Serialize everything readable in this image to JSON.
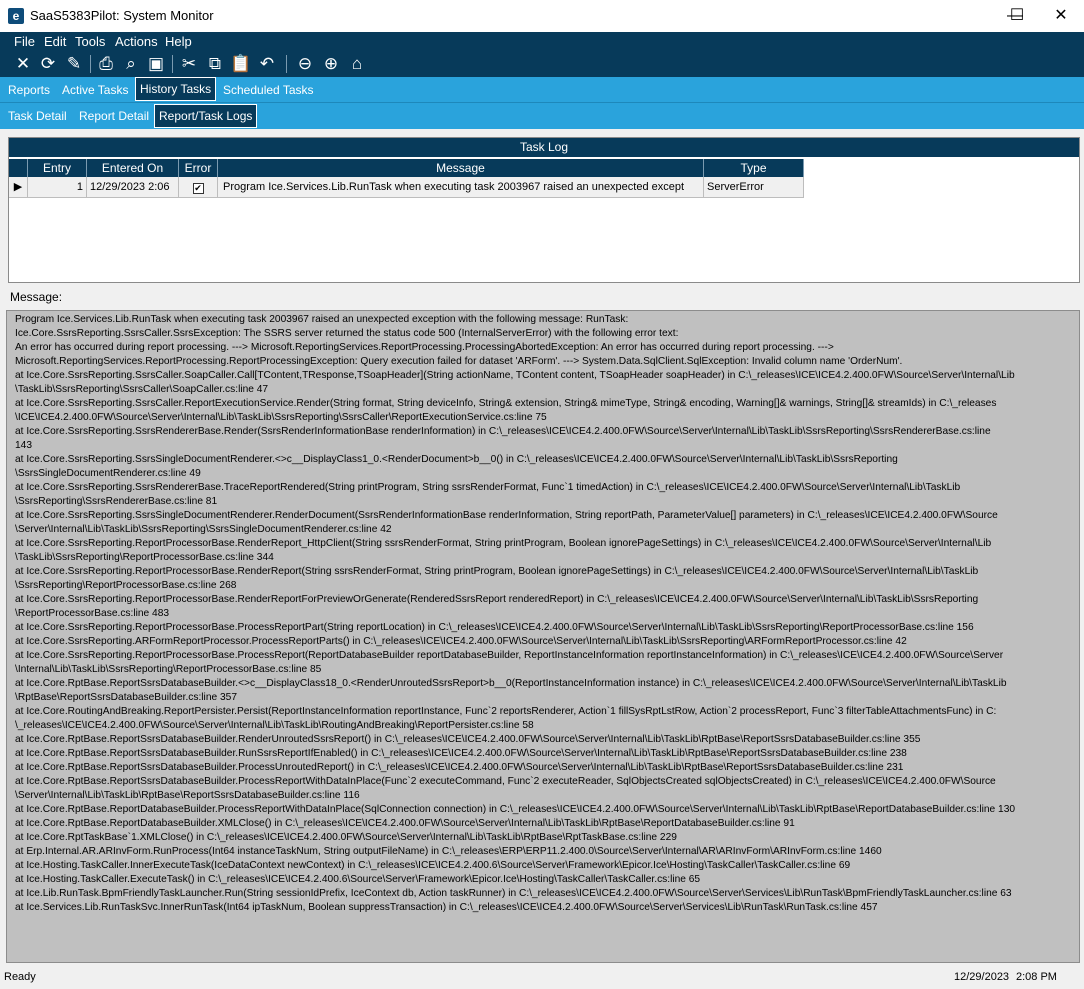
{
  "window": {
    "title": "SaaS5383Pilot: System Monitor",
    "app_icon_letter": "e"
  },
  "controls": {
    "minimize": "—",
    "maximize": "☐",
    "close": "✕"
  },
  "menu": [
    "File",
    "Edit",
    "Tools",
    "Actions",
    "Help"
  ],
  "toolbar": [
    "close-icon",
    "refresh-icon",
    "clear-icon",
    "print-icon",
    "print-preview-icon",
    "save-icon",
    "cut-icon",
    "copy-icon",
    "paste-icon",
    "undo-icon",
    "back-icon",
    "forward-icon",
    "home-icon"
  ],
  "tabs_main": [
    "Reports",
    "Active Tasks",
    "History Tasks",
    "Scheduled Tasks"
  ],
  "tabs_sub": [
    "Task Detail",
    "Report Detail",
    "Report/Task Logs"
  ],
  "grid": {
    "title": "Task Log",
    "columns": [
      "Entry",
      "Entered On",
      "Error",
      "Message",
      "Type"
    ],
    "row": {
      "entry": "1",
      "entered_on": "12/29/2023 2:06",
      "error": true,
      "message": "Program Ice.Services.Lib.RunTask when executing task 2003967 raised an unexpected except",
      "type": "ServerError"
    }
  },
  "message_label": "Message:",
  "message_lines": [
    "Program Ice.Services.Lib.RunTask when executing task 2003967 raised an unexpected exception with the following message: RunTask:",
    "Ice.Core.SsrsReporting.SsrsCaller.SsrsException: The SSRS server returned the status code 500 (InternalServerError) with the following error text:",
    "An error has occurred during report processing. ---> Microsoft.ReportingServices.ReportProcessing.ProcessingAbortedException: An error has occurred during report processing. --->",
    "Microsoft.ReportingServices.ReportProcessing.ReportProcessingException: Query execution failed for dataset 'ARForm'. ---> System.Data.SqlClient.SqlException: Invalid column name 'OrderNum'.",
    "   at Ice.Core.SsrsReporting.SsrsCaller.SoapCaller.Call[TContent,TResponse,TSoapHeader](String actionName, TContent content, TSoapHeader soapHeader) in C:\\_releases\\ICE\\ICE4.2.400.0FW\\Source\\Server\\Internal\\Lib",
    "\\TaskLib\\SsrsReporting\\SsrsCaller\\SoapCaller.cs:line 47",
    "   at Ice.Core.SsrsReporting.SsrsCaller.ReportExecutionService.Render(String format, String deviceInfo, String& extension, String& mimeType, String& encoding, Warning[]& warnings, String[]& streamIds) in C:\\_releases",
    "\\ICE\\ICE4.2.400.0FW\\Source\\Server\\Internal\\Lib\\TaskLib\\SsrsReporting\\SsrsCaller\\ReportExecutionService.cs:line 75",
    "   at Ice.Core.SsrsReporting.SsrsRendererBase.Render(SsrsRenderInformationBase renderInformation) in C:\\_releases\\ICE\\ICE4.2.400.0FW\\Source\\Server\\Internal\\Lib\\TaskLib\\SsrsReporting\\SsrsRendererBase.cs:line",
    "143",
    "   at Ice.Core.SsrsReporting.SsrsSingleDocumentRenderer.<>c__DisplayClass1_0.<RenderDocument>b__0() in C:\\_releases\\ICE\\ICE4.2.400.0FW\\Source\\Server\\Internal\\Lib\\TaskLib\\SsrsReporting",
    "\\SsrsSingleDocumentRenderer.cs:line 49",
    "   at Ice.Core.SsrsReporting.SsrsRendererBase.TraceReportRendered(String printProgram, String ssrsRenderFormat, Func`1 timedAction) in C:\\_releases\\ICE\\ICE4.2.400.0FW\\Source\\Server\\Internal\\Lib\\TaskLib",
    "\\SsrsReporting\\SsrsRendererBase.cs:line 81",
    "   at Ice.Core.SsrsReporting.SsrsSingleDocumentRenderer.RenderDocument(SsrsRenderInformationBase renderInformation, String reportPath, ParameterValue[] parameters) in C:\\_releases\\ICE\\ICE4.2.400.0FW\\Source",
    "\\Server\\Internal\\Lib\\TaskLib\\SsrsReporting\\SsrsSingleDocumentRenderer.cs:line 42",
    "   at Ice.Core.SsrsReporting.ReportProcessorBase.RenderReport_HttpClient(String ssrsRenderFormat, String printProgram, Boolean ignorePageSettings) in C:\\_releases\\ICE\\ICE4.2.400.0FW\\Source\\Server\\Internal\\Lib",
    "\\TaskLib\\SsrsReporting\\ReportProcessorBase.cs:line 344",
    "   at Ice.Core.SsrsReporting.ReportProcessorBase.RenderReport(String ssrsRenderFormat, String printProgram, Boolean ignorePageSettings) in C:\\_releases\\ICE\\ICE4.2.400.0FW\\Source\\Server\\Internal\\Lib\\TaskLib",
    "\\SsrsReporting\\ReportProcessorBase.cs:line 268",
    "   at Ice.Core.SsrsReporting.ReportProcessorBase.RenderReportForPreviewOrGenerate(RenderedSsrsReport renderedReport) in C:\\_releases\\ICE\\ICE4.2.400.0FW\\Source\\Server\\Internal\\Lib\\TaskLib\\SsrsReporting",
    "\\ReportProcessorBase.cs:line 483",
    "   at Ice.Core.SsrsReporting.ReportProcessorBase.ProcessReportPart(String reportLocation) in C:\\_releases\\ICE\\ICE4.2.400.0FW\\Source\\Server\\Internal\\Lib\\TaskLib\\SsrsReporting\\ReportProcessorBase.cs:line 156",
    "   at Ice.Core.SsrsReporting.ARFormReportProcessor.ProcessReportParts() in C:\\_releases\\ICE\\ICE4.2.400.0FW\\Source\\Server\\Internal\\Lib\\TaskLib\\SsrsReporting\\ARFormReportProcessor.cs:line 42",
    "   at Ice.Core.SsrsReporting.ReportProcessorBase.ProcessReport(ReportDatabaseBuilder reportDatabaseBuilder, ReportInstanceInformation reportInstanceInformation) in C:\\_releases\\ICE\\ICE4.2.400.0FW\\Source\\Server",
    "\\Internal\\Lib\\TaskLib\\SsrsReporting\\ReportProcessorBase.cs:line 85",
    "   at Ice.Core.RptBase.ReportSsrsDatabaseBuilder.<>c__DisplayClass18_0.<RenderUnroutedSsrsReport>b__0(ReportInstanceInformation instance) in C:\\_releases\\ICE\\ICE4.2.400.0FW\\Source\\Server\\Internal\\Lib\\TaskLib",
    "\\RptBase\\ReportSsrsDatabaseBuilder.cs:line 357",
    "   at Ice.Core.RoutingAndBreaking.ReportPersister.Persist(ReportInstanceInformation reportInstance, Func`2 reportsRenderer, Action`1 fillSysRptLstRow, Action`2 processReport, Func`3 filterTableAttachmentsFunc) in C:",
    "\\_releases\\ICE\\ICE4.2.400.0FW\\Source\\Server\\Internal\\Lib\\TaskLib\\RoutingAndBreaking\\ReportPersister.cs:line 58",
    "   at Ice.Core.RptBase.ReportSsrsDatabaseBuilder.RenderUnroutedSsrsReport() in C:\\_releases\\ICE\\ICE4.2.400.0FW\\Source\\Server\\Internal\\Lib\\TaskLib\\RptBase\\ReportSsrsDatabaseBuilder.cs:line 355",
    "   at Ice.Core.RptBase.ReportSsrsDatabaseBuilder.RunSsrsReportIfEnabled() in C:\\_releases\\ICE\\ICE4.2.400.0FW\\Source\\Server\\Internal\\Lib\\TaskLib\\RptBase\\ReportSsrsDatabaseBuilder.cs:line 238",
    "   at Ice.Core.RptBase.ReportSsrsDatabaseBuilder.ProcessUnroutedReport() in C:\\_releases\\ICE\\ICE4.2.400.0FW\\Source\\Server\\Internal\\Lib\\TaskLib\\RptBase\\ReportSsrsDatabaseBuilder.cs:line 231",
    "   at Ice.Core.RptBase.ReportSsrsDatabaseBuilder.ProcessReportWithDataInPlace(Func`2 executeCommand, Func`2 executeReader, SqlObjectsCreated sqlObjectsCreated) in C:\\_releases\\ICE\\ICE4.2.400.0FW\\Source",
    "\\Server\\Internal\\Lib\\TaskLib\\RptBase\\ReportSsrsDatabaseBuilder.cs:line 116",
    "   at Ice.Core.RptBase.ReportDatabaseBuilder.ProcessReportWithDataInPlace(SqlConnection connection) in C:\\_releases\\ICE\\ICE4.2.400.0FW\\Source\\Server\\Internal\\Lib\\TaskLib\\RptBase\\ReportDatabaseBuilder.cs:line 130",
    "   at Ice.Core.RptBase.ReportDatabaseBuilder.XMLClose() in C:\\_releases\\ICE\\ICE4.2.400.0FW\\Source\\Server\\Internal\\Lib\\TaskLib\\RptBase\\ReportDatabaseBuilder.cs:line 91",
    "   at Ice.Core.RptTaskBase`1.XMLClose() in C:\\_releases\\ICE\\ICE4.2.400.0FW\\Source\\Server\\Internal\\Lib\\TaskLib\\RptBase\\RptTaskBase.cs:line 229",
    "   at Erp.Internal.AR.ARInvForm.RunProcess(Int64 instanceTaskNum, String outputFileName) in C:\\_releases\\ERP\\ERP11.2.400.0\\Source\\Server\\Internal\\AR\\ARInvForm\\ARInvForm.cs:line 1460",
    "   at Ice.Hosting.TaskCaller.InnerExecuteTask(IceDataContext newContext) in C:\\_releases\\ICE\\ICE4.2.400.6\\Source\\Server\\Framework\\Epicor.Ice\\Hosting\\TaskCaller\\TaskCaller.cs:line 69",
    "   at Ice.Hosting.TaskCaller.ExecuteTask() in C:\\_releases\\ICE\\ICE4.2.400.6\\Source\\Server\\Framework\\Epicor.Ice\\Hosting\\TaskCaller\\TaskCaller.cs:line 65",
    "   at Ice.Lib.RunTask.BpmFriendlyTaskLauncher.Run(String sessionIdPrefix, IceContext db, Action taskRunner) in C:\\_releases\\ICE\\ICE4.2.400.0FW\\Source\\Server\\Services\\Lib\\RunTask\\BpmFriendlyTaskLauncher.cs:line 63",
    "   at Ice.Services.Lib.RunTaskSvc.InnerRunTask(Int64 ipTaskNum, Boolean suppressTransaction) in C:\\_releases\\ICE\\ICE4.2.400.0FW\\Source\\Server\\Services\\Lib\\RunTask\\RunTask.cs:line 457"
  ],
  "status": {
    "left": "Ready",
    "date": "12/29/2023",
    "time": "2:08 PM"
  }
}
